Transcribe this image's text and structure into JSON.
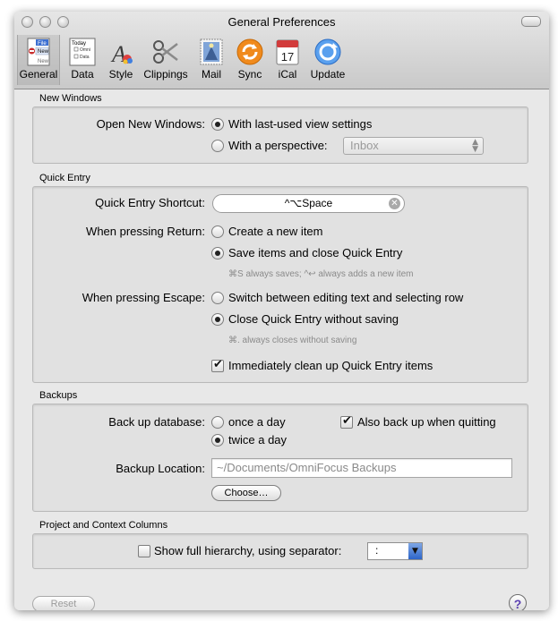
{
  "window": {
    "title": "General Preferences"
  },
  "toolbar": {
    "items": [
      {
        "label": "General",
        "icon": "general-prefs-icon"
      },
      {
        "label": "Data",
        "icon": "data-outline-icon"
      },
      {
        "label": "Style",
        "icon": "style-brush-icon"
      },
      {
        "label": "Clippings",
        "icon": "scissors-icon"
      },
      {
        "label": "Mail",
        "icon": "mail-stamp-icon"
      },
      {
        "label": "Sync",
        "icon": "sync-arrows-icon"
      },
      {
        "label": "iCal",
        "icon": "calendar-icon"
      },
      {
        "label": "Update",
        "icon": "software-update-icon"
      }
    ],
    "icon_texts": {
      "general_file": "File",
      "general_new": "New",
      "general_new2": "New",
      "data_today": "Today",
      "data_omni": "Omni",
      "data_row": "Data",
      "ical_day": "17"
    }
  },
  "new_windows": {
    "header": "New Windows",
    "label": "Open New Windows:",
    "option_last_used": "With last-used view settings",
    "option_perspective": "With a perspective:",
    "perspective_value": "Inbox"
  },
  "quick_entry": {
    "header": "Quick Entry",
    "shortcut_label": "Quick Entry Shortcut:",
    "shortcut_value": "^⌥Space",
    "return_label": "When pressing Return:",
    "return_option_create": "Create a new item",
    "return_option_save": "Save items and close Quick Entry",
    "return_hint": "⌘S always saves; ^↩ always adds a new item",
    "escape_label": "When pressing Escape:",
    "escape_option_switch": "Switch between editing text and selecting row",
    "escape_option_close": "Close Quick Entry without saving",
    "escape_hint": "⌘. always closes without saving",
    "cleanup_label": "Immediately clean up Quick Entry items"
  },
  "backups": {
    "header": "Backups",
    "label": "Back up database:",
    "option_once": "once a day",
    "option_twice": "twice a day",
    "also_quit": "Also back up when quitting",
    "location_label": "Backup Location:",
    "location_value": "~/Documents/OmniFocus Backups",
    "choose_button": "Choose…"
  },
  "columns": {
    "header": "Project and Context Columns",
    "full_hierarchy": "Show full hierarchy, using separator:",
    "separator_value": ":"
  },
  "footer": {
    "reset_button": "Reset",
    "help_button": "?"
  },
  "colors": {
    "window_bg": "#e8e8e8",
    "group_bg": "#e1e1e1",
    "hint_text": "#8a8a8a"
  }
}
